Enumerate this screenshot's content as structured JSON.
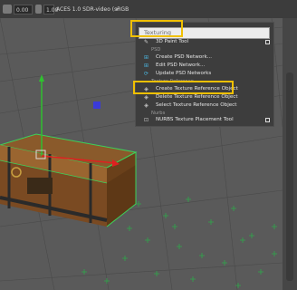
{
  "toolbar": {
    "exposure_value": "0.00",
    "gamma_value": "1.00",
    "view_transform": "ACES 1.0 SDR-video (sRGB"
  },
  "menu": {
    "search_placeholder": "Texturing",
    "items": [
      {
        "label": "3D Paint Tool",
        "icon": "paint-brush-icon",
        "has_options": true
      },
      {
        "section": "PSD"
      },
      {
        "label": "Create PSD Network...",
        "icon": "psd-network-icon"
      },
      {
        "label": "Edit PSD Network...",
        "icon": "psd-network-icon"
      },
      {
        "label": "Update PSD Networks",
        "icon": "psd-update-icon"
      },
      {
        "section": "Texture Reference"
      },
      {
        "label": "Create Texture Reference Object",
        "icon": "texture-reference-icon",
        "highlighted": true
      },
      {
        "label": "Delete Texture Reference Object",
        "icon": "texture-reference-icon"
      },
      {
        "label": "Select Texture Reference Object",
        "icon": "texture-reference-icon"
      },
      {
        "section": "Nurbs"
      },
      {
        "label": "NURBS Texture Placement Tool",
        "icon": "nurbs-placement-icon",
        "has_options": true
      }
    ]
  },
  "colors": {
    "highlight": "#f0c000",
    "wireframe": "#3cd15a",
    "manipulator_y": "#30c030",
    "manipulator_x": "#e02020",
    "manipulator_z": "#3a3ad8"
  }
}
